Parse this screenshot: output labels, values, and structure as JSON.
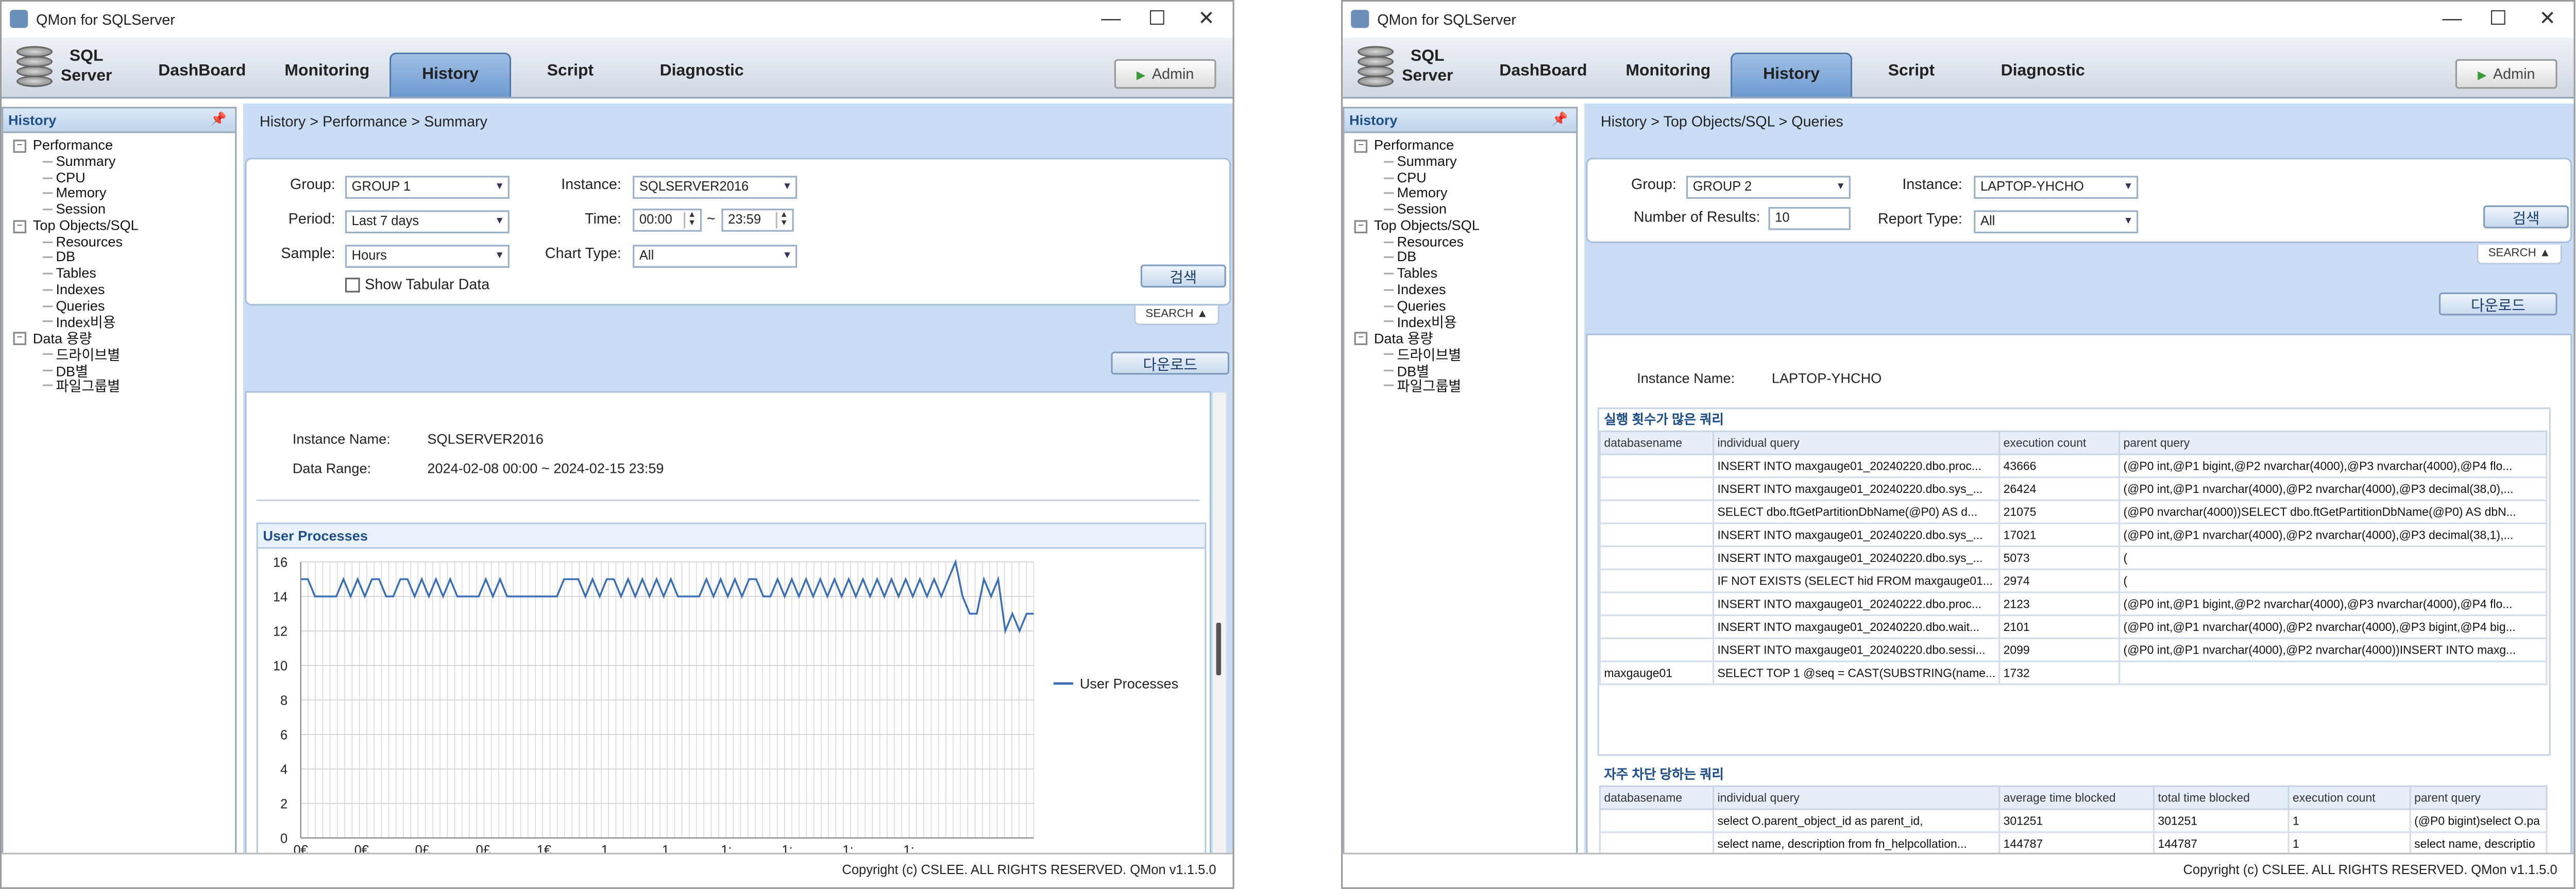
{
  "app": {
    "title": "QMon for SQLServer",
    "logo_line1": "SQL",
    "logo_line2": "Server",
    "tabs": [
      "DashBoard",
      "Monitoring",
      "History",
      "Script",
      "Diagnostic"
    ],
    "active_tab": "History",
    "admin_label": "Admin",
    "window_controls": {
      "minimize": "—",
      "maximize": "☐",
      "close": "✕"
    },
    "footer": "Copyright (c) CSLEE. ALL RIGHTS RESERVED. QMon v1.1.5.0"
  },
  "sidebar": {
    "title": "History",
    "tree": [
      {
        "label": "Performance",
        "level": 0,
        "toggle": "−"
      },
      {
        "label": "Summary",
        "level": 1
      },
      {
        "label": "CPU",
        "level": 1
      },
      {
        "label": "Memory",
        "level": 1
      },
      {
        "label": "Session",
        "level": 1
      },
      {
        "label": "Top Objects/SQL",
        "level": 0,
        "toggle": "−"
      },
      {
        "label": "Resources",
        "level": 1
      },
      {
        "label": "DB",
        "level": 1
      },
      {
        "label": "Tables",
        "level": 1
      },
      {
        "label": "Indexes",
        "level": 1
      },
      {
        "label": "Queries",
        "level": 1
      },
      {
        "label": "Index비용",
        "level": 1
      },
      {
        "label": "Data 용량",
        "level": 0,
        "toggle": "−"
      },
      {
        "label": "드라이브별",
        "level": 1
      },
      {
        "label": "DB별",
        "level": 1
      },
      {
        "label": "파일그룹별",
        "level": 1
      }
    ]
  },
  "left": {
    "breadcrumb": "History > Performance > Summary",
    "form": {
      "group_label": "Group:",
      "group_value": "GROUP 1",
      "period_label": "Period:",
      "period_value": "Last 7 days",
      "sample_label": "Sample:",
      "sample_value": "Hours",
      "show_tabular": "Show Tabular Data",
      "instance_label": "Instance:",
      "instance_value": "SQLSERVER2016",
      "time_label": "Time:",
      "time_from": "00:00",
      "time_sep": "~",
      "time_to": "23:59",
      "chart_type_label": "Chart Type:",
      "chart_type_value": "All",
      "search_button": "검색",
      "search_toggle": "SEARCH ▲"
    },
    "download_button": "다운로드",
    "info": {
      "instance_label": "Instance Name:",
      "instance_value": "SQLSERVER2016",
      "range_label": "Data Range:",
      "range_value": "2024-02-08 00:00 ~ 2024-02-15 23:59"
    }
  },
  "chart_data": {
    "type": "line",
    "title": "User Processes",
    "ylim": [
      0,
      16
    ],
    "yticks": [
      0,
      2,
      4,
      6,
      8,
      10,
      12,
      14,
      16
    ],
    "xticks": [
      "0€",
      "0€",
      "0£",
      "0£",
      "1€",
      "1",
      "1",
      "1:",
      "1:",
      "1:",
      "1:"
    ],
    "legend": "top-right",
    "series": [
      {
        "name": "User Processes",
        "color": "#3a6fb8",
        "values": [
          15,
          15,
          14,
          14,
          14,
          14,
          15,
          14,
          15,
          14,
          15,
          15,
          14,
          14,
          15,
          15,
          14,
          15,
          14,
          15,
          14,
          15,
          14,
          14,
          14,
          14,
          15,
          14,
          15,
          14,
          14,
          14,
          14,
          14,
          14,
          14,
          14,
          15,
          15,
          15,
          14,
          15,
          14,
          15,
          15,
          14,
          15,
          14,
          15,
          14,
          15,
          14,
          15,
          14,
          14,
          14,
          14,
          15,
          14,
          15,
          14,
          15,
          14,
          15,
          15,
          14,
          14,
          15,
          14,
          15,
          14,
          15,
          14,
          15,
          14,
          15,
          14,
          15,
          14,
          15,
          14,
          15,
          14,
          15,
          14,
          15,
          14,
          15,
          14,
          15,
          14,
          15,
          16,
          14,
          13,
          13,
          15,
          14,
          15,
          12,
          13,
          12,
          13,
          13
        ]
      }
    ]
  },
  "right": {
    "breadcrumb": "History > Top Objects/SQL > Queries",
    "form": {
      "group_label": "Group:",
      "group_value": "GROUP 2",
      "results_label": "Number of Results:",
      "results_value": "10",
      "instance_label": "Instance:",
      "instance_value": "LAPTOP-YHCHO",
      "report_label": "Report Type:",
      "report_value": "All",
      "search_button": "검색",
      "search_toggle": "SEARCH ▲"
    },
    "download_button": "다운로드",
    "info": {
      "instance_label": "Instance Name:",
      "instance_value": "LAPTOP-YHCHO"
    },
    "grid1": {
      "title": "실행 횟수가 많은 쿼리",
      "columns": [
        "databasename",
        "individual query",
        "execution count",
        "parent query"
      ],
      "rows": [
        [
          "",
          "INSERT INTO maxgauge01_20240220.dbo.proc...",
          "43666",
          "(@P0 int,@P1 bigint,@P2 nvarchar(4000),@P3 nvarchar(4000),@P4 flo..."
        ],
        [
          "",
          "INSERT INTO maxgauge01_20240220.dbo.sys_...",
          "26424",
          "(@P0 int,@P1 nvarchar(4000),@P2 nvarchar(4000),@P3 decimal(38,0),..."
        ],
        [
          "",
          "SELECT dbo.ftGetPartitionDbName(@P0) AS d...",
          "21075",
          "(@P0 nvarchar(4000))SELECT dbo.ftGetPartitionDbName(@P0) AS dbN..."
        ],
        [
          "",
          "INSERT INTO maxgauge01_20240220.dbo.sys_...",
          "17021",
          "(@P0 int,@P1 nvarchar(4000),@P2 nvarchar(4000),@P3 decimal(38,1),..."
        ],
        [
          "",
          "INSERT INTO maxgauge01_20240220.dbo.sys_...",
          "5073",
          "("
        ],
        [
          "",
          "IF NOT EXISTS (SELECT hid FROM maxgauge01...",
          "2974",
          "("
        ],
        [
          "",
          "INSERT INTO maxgauge01_20240222.dbo.proc...",
          "2123",
          "(@P0 int,@P1 bigint,@P2 nvarchar(4000),@P3 nvarchar(4000),@P4 flo..."
        ],
        [
          "",
          "INSERT INTO maxgauge01_20240220.dbo.wait...",
          "2101",
          "(@P0 int,@P1 nvarchar(4000),@P2 nvarchar(4000),@P3 bigint,@P4 big..."
        ],
        [
          "",
          "INSERT INTO maxgauge01_20240220.dbo.sessi...",
          "2099",
          "(@P0 int,@P1 nvarchar(4000),@P2 nvarchar(4000))INSERT INTO maxg..."
        ],
        [
          "maxgauge01",
          "SELECT TOP 1 @seq = CAST(SUBSTRING(name...",
          "1732",
          ""
        ]
      ]
    },
    "grid2": {
      "title": "자주 차단 당하는 쿼리",
      "columns": [
        "databasename",
        "individual query",
        "average time blocked",
        "total time blocked",
        "execution count",
        "parent query"
      ],
      "rows": [
        [
          "",
          "select O.parent_object_id as parent_id,",
          "301251",
          "301251",
          "1",
          "(@P0 bigint)select O.pa"
        ],
        [
          "",
          "select name, description from fn_helpcollation...",
          "144787",
          "144787",
          "1",
          "select name, descriptio"
        ]
      ]
    }
  }
}
